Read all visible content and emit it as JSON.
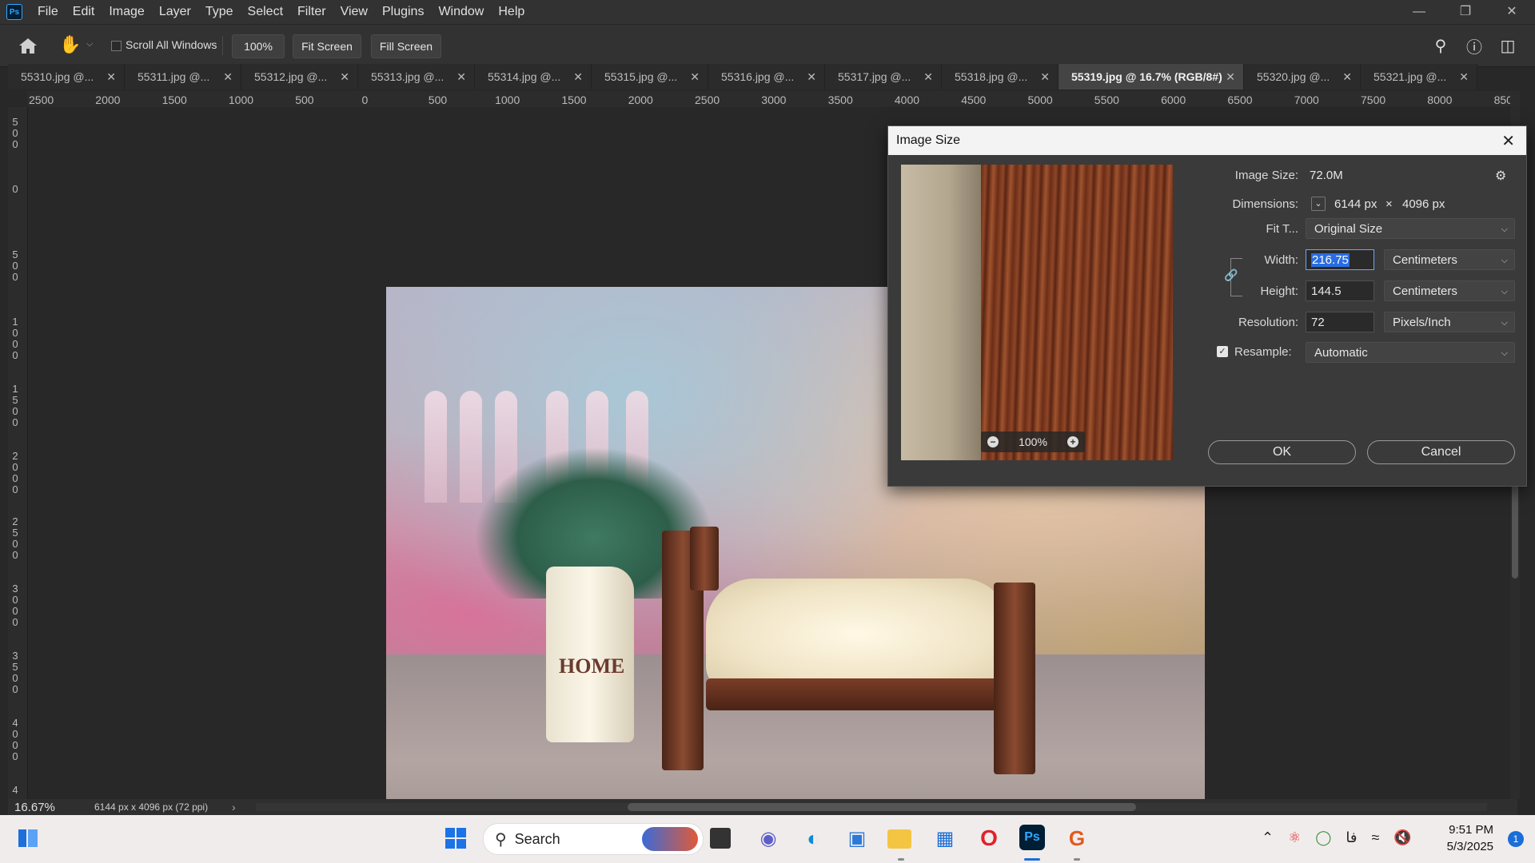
{
  "app": {
    "logo": "Ps",
    "menu": [
      "File",
      "Edit",
      "Image",
      "Layer",
      "Type",
      "Select",
      "Filter",
      "View",
      "Plugins",
      "Window",
      "Help"
    ],
    "window_controls": [
      "minimize-icon",
      "restore-icon",
      "close-icon"
    ]
  },
  "options": {
    "scroll_all_windows": "Scroll All Windows",
    "zoom_value": "100%",
    "fit_screen": "Fit Screen",
    "fill_screen": "Fill Screen"
  },
  "tabs": [
    {
      "label": "55310.jpg @..."
    },
    {
      "label": "55311.jpg @..."
    },
    {
      "label": "55312.jpg @..."
    },
    {
      "label": "55313.jpg @..."
    },
    {
      "label": "55314.jpg @..."
    },
    {
      "label": "55315.jpg @..."
    },
    {
      "label": "55316.jpg @..."
    },
    {
      "label": "55317.jpg @..."
    },
    {
      "label": "55318.jpg @..."
    },
    {
      "label": "55319.jpg @ 16.7% (RGB/8#)",
      "active": true
    },
    {
      "label": "55320.jpg @..."
    },
    {
      "label": "55321.jpg @..."
    }
  ],
  "ruler_h": [
    "2500",
    "2000",
    "1500",
    "1000",
    "500",
    "0",
    "500",
    "1000",
    "1500",
    "2000",
    "2500",
    "3000",
    "3500",
    "4000",
    "4500",
    "5000",
    "5500",
    "6000",
    "6500",
    "7000",
    "7500",
    "8000",
    "850"
  ],
  "ruler_v": [
    "500",
    "0",
    "500",
    "1000",
    "1500",
    "2000",
    "2500",
    "3000",
    "3500",
    "4000",
    "4"
  ],
  "photo": {
    "vase_text": "HOME"
  },
  "dialog": {
    "title": "Image Size",
    "image_size_label": "Image Size:",
    "image_size_value": "72.0M",
    "dimensions_label": "Dimensions:",
    "dim_w": "6144 px",
    "dim_x": "×",
    "dim_h": "4096 px",
    "fit_label": "Fit T...",
    "fit_value": "Original Size",
    "width_label": "Width:",
    "width_value": "216.75",
    "width_unit": "Centimeters",
    "height_label": "Height:",
    "height_value": "144.5",
    "height_unit": "Centimeters",
    "resolution_label": "Resolution:",
    "resolution_value": "72",
    "resolution_unit": "Pixels/Inch",
    "resample_label": "Resample:",
    "resample_value": "Automatic",
    "preview_zoom": "100%",
    "ok": "OK",
    "cancel": "Cancel"
  },
  "status": {
    "zoom": "16.67%",
    "info": "6144 px x 4096 px (72 ppi)"
  },
  "taskbar": {
    "search": "Search",
    "time": "9:51 PM",
    "date": "5/3/2025",
    "lang": "فا",
    "notifications": "1"
  }
}
